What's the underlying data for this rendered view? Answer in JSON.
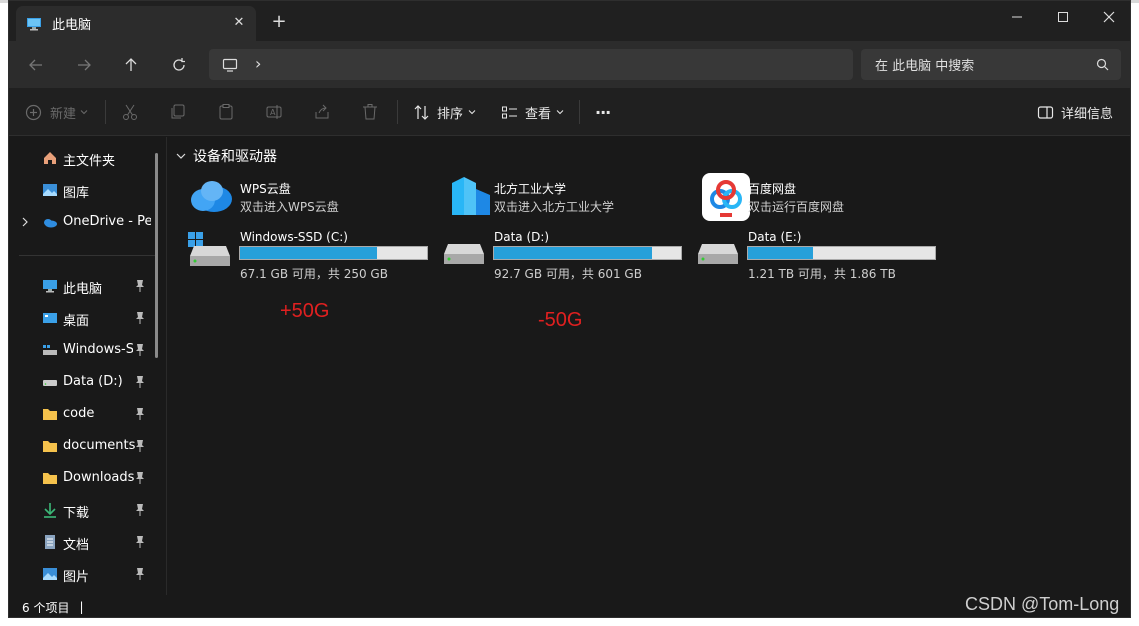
{
  "window": {
    "tab_title": "此电脑",
    "tab_close": "✕",
    "new_tab": "+"
  },
  "nav": {
    "search_placeholder": "在 此电脑 中搜索",
    "breadcrumb_sep": "›"
  },
  "toolbar": {
    "new_label": "新建",
    "sort_label": "排序",
    "view_label": "查看",
    "more_label": "···",
    "details_label": "详细信息"
  },
  "sidebar": {
    "items": [
      {
        "label": "主文件夹",
        "icon": "home-icon"
      },
      {
        "label": "图库",
        "icon": "gallery-icon"
      },
      {
        "label": "OneDrive - Per",
        "icon": "onedrive-icon"
      },
      {
        "label": "此电脑",
        "icon": "computer-icon"
      },
      {
        "label": "桌面",
        "icon": "desktop-icon"
      },
      {
        "label": "Windows-SSD",
        "icon": "drive-icon"
      },
      {
        "label": "Data (D:)",
        "icon": "drive-icon"
      },
      {
        "label": "code",
        "icon": "folder-icon"
      },
      {
        "label": "documents",
        "icon": "folder-icon"
      },
      {
        "label": "Downloads",
        "icon": "folder-icon"
      },
      {
        "label": "下载",
        "icon": "download-icon"
      },
      {
        "label": "文档",
        "icon": "document-icon"
      },
      {
        "label": "图片",
        "icon": "pictures-icon"
      }
    ]
  },
  "content": {
    "section_title": "设备和驱动器",
    "apps": [
      {
        "title": "WPS云盘",
        "subtitle": "双击进入WPS云盘"
      },
      {
        "title": "北方工业大学",
        "subtitle": "双击进入北方工业大学"
      },
      {
        "title": "百度网盘",
        "subtitle": "双击运行百度网盘"
      }
    ],
    "drives": [
      {
        "name": "Windows-SSD (C:)",
        "free_text": "67.1 GB 可用，共 250 GB",
        "used_fraction": 0.732
      },
      {
        "name": "Data (D:)",
        "free_text": "92.7 GB 可用，共 601 GB",
        "used_fraction": 0.846
      },
      {
        "name": "Data (E:)",
        "free_text": "1.21 TB 可用，共 1.86 TB",
        "used_fraction": 0.349
      }
    ],
    "annotations": [
      "+50G",
      "-50G"
    ]
  },
  "status": {
    "count": "6 个项目",
    "sep": "|"
  },
  "watermark": "CSDN @Tom-Long",
  "colors": {
    "accent": "#26a0da",
    "annotation": "#e02020",
    "background": "#191919"
  }
}
